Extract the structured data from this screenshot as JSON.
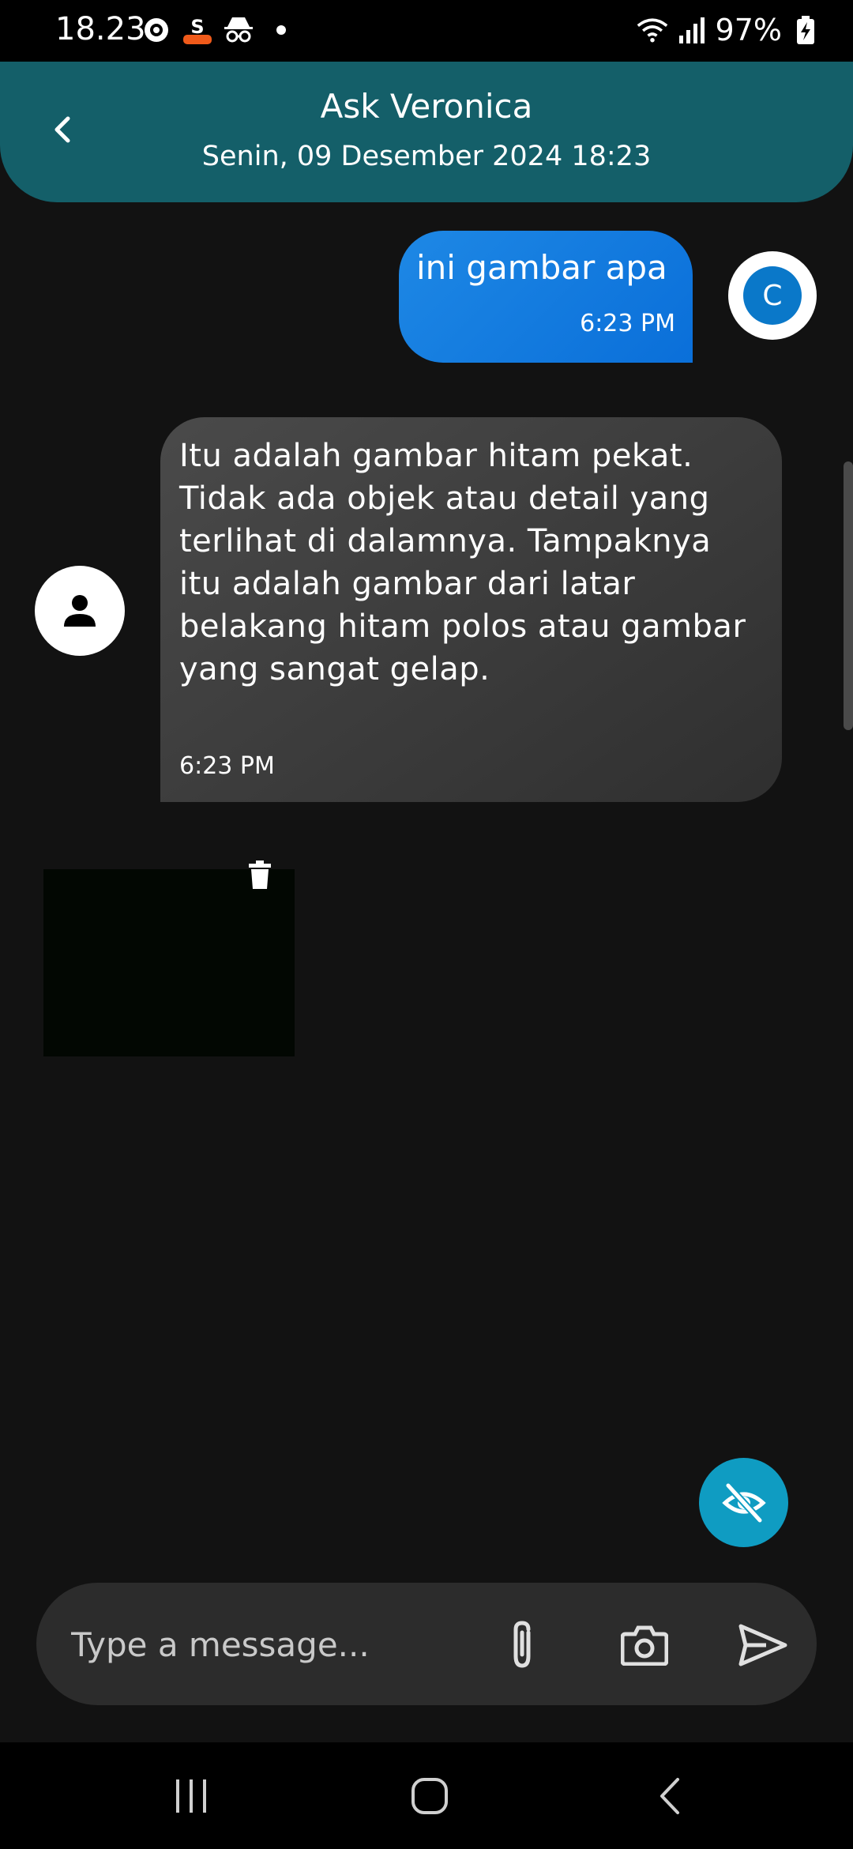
{
  "status_bar": {
    "time": "18.23",
    "battery": "97%"
  },
  "header": {
    "title": "Ask Veronica",
    "subtitle": "Senin, 09 Desember 2024 18:23"
  },
  "messages": [
    {
      "sender": "user",
      "text": "ini gambar apa",
      "time": "6:23 PM",
      "avatar_initial": "C"
    },
    {
      "sender": "bot",
      "text": "Itu adalah gambar hitam pekat. Tidak ada objek atau detail yang terlihat di dalamnya.  Tampaknya itu adalah gambar dari latar belakang hitam polos atau gambar yang sangat gelap.",
      "time": "6:23 PM"
    }
  ],
  "composer": {
    "placeholder": "Type a message...",
    "value": ""
  },
  "colors": {
    "header_bg": "#145f69",
    "user_bubble": "#1e88e5",
    "bot_bubble": "#3a3a3a",
    "fab": "#0f9cc2",
    "user_avatar": "#0a78c9"
  },
  "icons": {
    "back": "chevron-left-icon",
    "trash": "trash-icon",
    "fab": "eye-off-icon",
    "attach": "paperclip-icon",
    "camera": "camera-icon",
    "send": "send-icon",
    "bot_avatar": "person-icon"
  }
}
